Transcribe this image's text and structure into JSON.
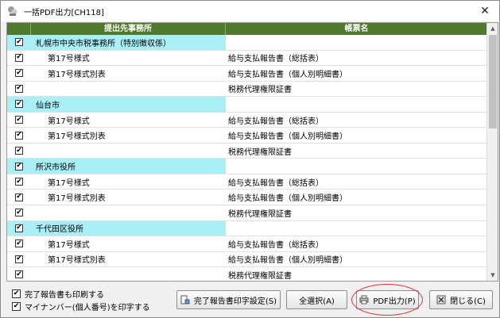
{
  "window": {
    "title": "一括PDF出力[CH118]",
    "close_glyph": "✕"
  },
  "grid": {
    "headers": {
      "office": "提出先事務所",
      "form": "帳票名"
    },
    "rows": [
      {
        "type": "group",
        "office": "札幌市中央市税事務所（特別徴収係）",
        "form": ""
      },
      {
        "type": "sub",
        "office": "第17号様式",
        "form": "給与支払報告書（総括表）"
      },
      {
        "type": "sub",
        "office": "第17号様式別表",
        "form": "給与支払報告書（個人別明細書）"
      },
      {
        "type": "sub",
        "office": "",
        "form": "税務代理権限証書"
      },
      {
        "type": "group",
        "office": "仙台市",
        "form": ""
      },
      {
        "type": "sub",
        "office": "第17号様式",
        "form": "給与支払報告書（総括表）"
      },
      {
        "type": "sub",
        "office": "第17号様式別表",
        "form": "給与支払報告書（個人別明細書）"
      },
      {
        "type": "sub",
        "office": "",
        "form": "税務代理権限証書"
      },
      {
        "type": "group",
        "office": "所沢市役所",
        "form": ""
      },
      {
        "type": "sub",
        "office": "第17号様式",
        "form": "給与支払報告書（総括表）"
      },
      {
        "type": "sub",
        "office": "第17号様式別表",
        "form": "給与支払報告書（個人別明細書）"
      },
      {
        "type": "sub",
        "office": "",
        "form": "税務代理権限証書"
      },
      {
        "type": "group",
        "office": "千代田区役所",
        "form": ""
      },
      {
        "type": "sub",
        "office": "第17号様式",
        "form": "給与支払報告書（総括表）"
      },
      {
        "type": "sub",
        "office": "第17号様式別表",
        "form": "給与支払報告書（個人別明細書）"
      },
      {
        "type": "sub",
        "office": "",
        "form": "税務代理権限証書"
      }
    ],
    "check_glyph": "✔"
  },
  "options": {
    "print_completion": "完了報告書も印刷する",
    "print_mynumber": "マイナンバー(個人番号)を印字する"
  },
  "buttons": {
    "completion_settings": "完了報告書印字設定(S)",
    "select_all": "全選択(A)",
    "pdf_output": "PDF出力(P)",
    "close": "閉じる(C)"
  },
  "colors": {
    "header_bg": "#4f7a2e",
    "group_bg": "#aaeef6",
    "highlight": "#e0303a"
  }
}
